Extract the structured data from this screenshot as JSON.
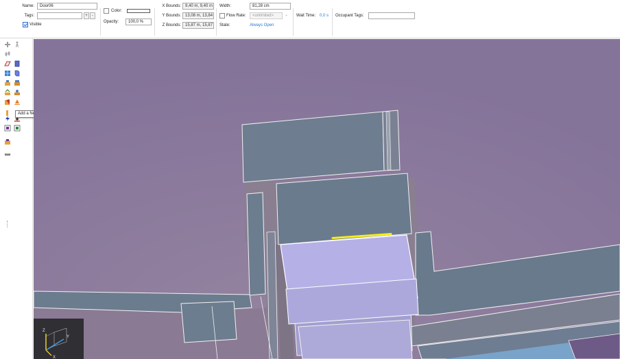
{
  "props": {
    "name_label": "Name:",
    "name_value": "Door06",
    "tags_label": "Tags:",
    "tags_value": "",
    "tags_add": "+",
    "tags_remove": "-",
    "visible_label": "Visible",
    "visible_checked": true,
    "color_label": "Color:",
    "opacity_label": "Opacity:",
    "opacity_value": "100,0 %",
    "xbounds_label": "X Bounds:",
    "xbounds_value": "9,40 m, 9,40 m",
    "ybounds_label": "Y Bounds:",
    "ybounds_value": "13,08 m, 13,84",
    "zbounds_label": "Z Bounds:",
    "zbounds_value": "15,87 m, 15,87",
    "width_label": "Width:",
    "width_value": "81,28 cm",
    "flowrate_label": "Flow Rate:",
    "flowrate_value": "<unlimited>",
    "state_label": "State:",
    "state_value": "Always Open",
    "waittime_label": "Wait Time:",
    "waittime_value": "0,0 s",
    "occupant_tags_label": "Occupant Tags:",
    "occupant_tags_value": ""
  },
  "toolbar": {
    "tooltip": "Add a New Door",
    "tools": [
      "add-node-icon",
      "walk-icon",
      "footprints-icon",
      "room-icon",
      "door-icon",
      "floor-icon",
      "stair-icon",
      "occupant-icon",
      "group-icon",
      "path-icon",
      "target-icon",
      "exit-icon",
      "warning-cone-icon",
      "add-door-icon",
      "lightning-icon",
      "download-icon",
      "filled-square-icon",
      "green-square-icon",
      "box-icon",
      "ruler-icon"
    ]
  },
  "viewport": {
    "background": "#87769a",
    "selected_door_color": "#f6ee1a",
    "axis_labels": [
      "Z",
      "Y",
      "X"
    ]
  }
}
